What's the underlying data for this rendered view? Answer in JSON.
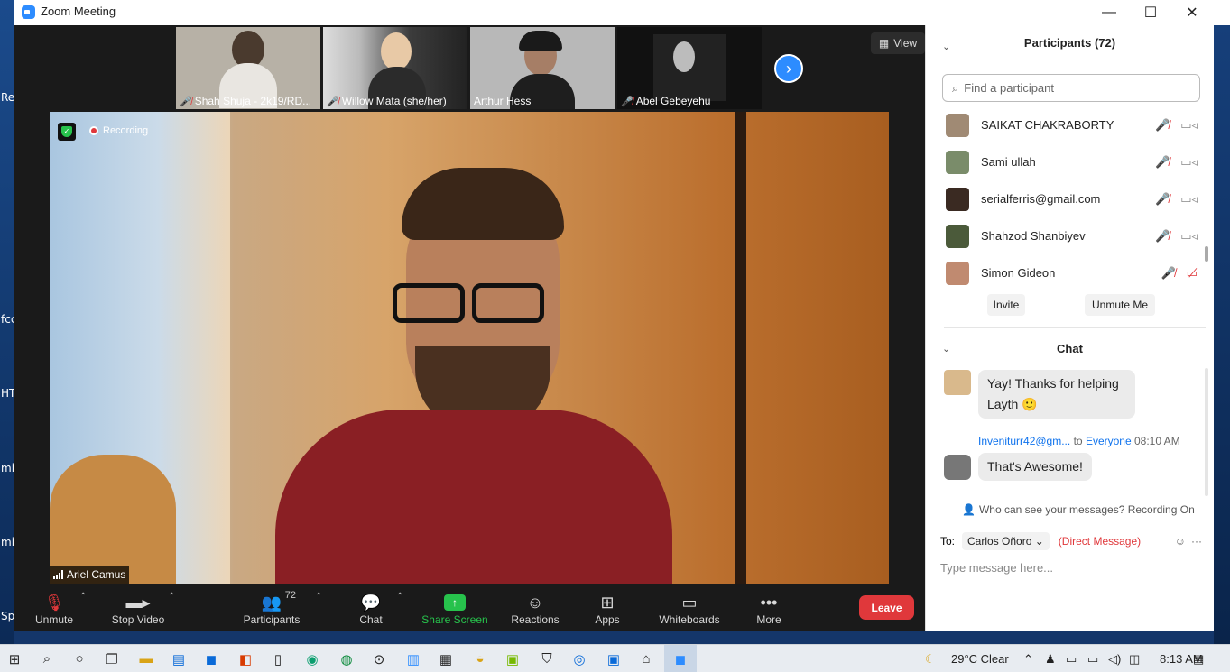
{
  "window": {
    "title": "Zoom Meeting",
    "min": "—",
    "max": "☐",
    "close": "✕"
  },
  "desktop_bleed": [
    "Re",
    "fcc",
    "HT",
    "mi",
    "mi",
    "Sp"
  ],
  "gallery": {
    "view_label": "View",
    "tiles": [
      {
        "name": "Shah Shuja - 2k19/RD...",
        "bg": "#b7b1a6"
      },
      {
        "name": "Willow Mata (she/her)",
        "bg": "#9a8b79"
      },
      {
        "name": "Arthur Hess",
        "bg": "#b8b8b8"
      },
      {
        "name": "Abel Gebeyehu",
        "bg": "#111111"
      }
    ],
    "next_icon": "›"
  },
  "main_video": {
    "recording_label": "Recording",
    "speaker": "Ariel Camus"
  },
  "toolbar": {
    "unmute": "Unmute",
    "stop_video": "Stop Video",
    "participants": "Participants",
    "participant_count": "72",
    "chat": "Chat",
    "share_screen": "Share Screen",
    "reactions": "Reactions",
    "apps": "Apps",
    "whiteboards": "Whiteboards",
    "more": "More",
    "leave": "Leave"
  },
  "participants_panel": {
    "title": "Participants (72)",
    "search_placeholder": "Find a participant",
    "list": [
      {
        "name": "SAIKAT CHAKRABORTY",
        "video_off": false
      },
      {
        "name": "Sami ullah",
        "video_off": false
      },
      {
        "name": "serialferris@gmail.com",
        "video_off": false
      },
      {
        "name": "Shahzod Shanbiyev",
        "video_off": false
      },
      {
        "name": "Simon Gideon",
        "video_off": true
      }
    ],
    "invite": "Invite",
    "unmute_me": "Unmute Me"
  },
  "chat_panel": {
    "title": "Chat",
    "messages": [
      {
        "text": "Yay! Thanks for helping Layth 🙂"
      },
      {
        "sender": "Inveniturr42@gm...",
        "to_word": "to",
        "to": "Everyone",
        "time": "08:10 AM",
        "text": "That's Awesome!"
      }
    ],
    "visibility_note": "Who can see your messages? Recording On",
    "to_label": "To:",
    "recipient": "Carlos Oñoro",
    "direct_message": "(Direct Message)",
    "input_placeholder": "Type message here..."
  },
  "taskbar": {
    "weather": "29°C  Clear",
    "time": "8:13 AM"
  },
  "colors": {
    "accent": "#2d8cff",
    "danger": "#e0383b",
    "share": "#27c24c"
  }
}
